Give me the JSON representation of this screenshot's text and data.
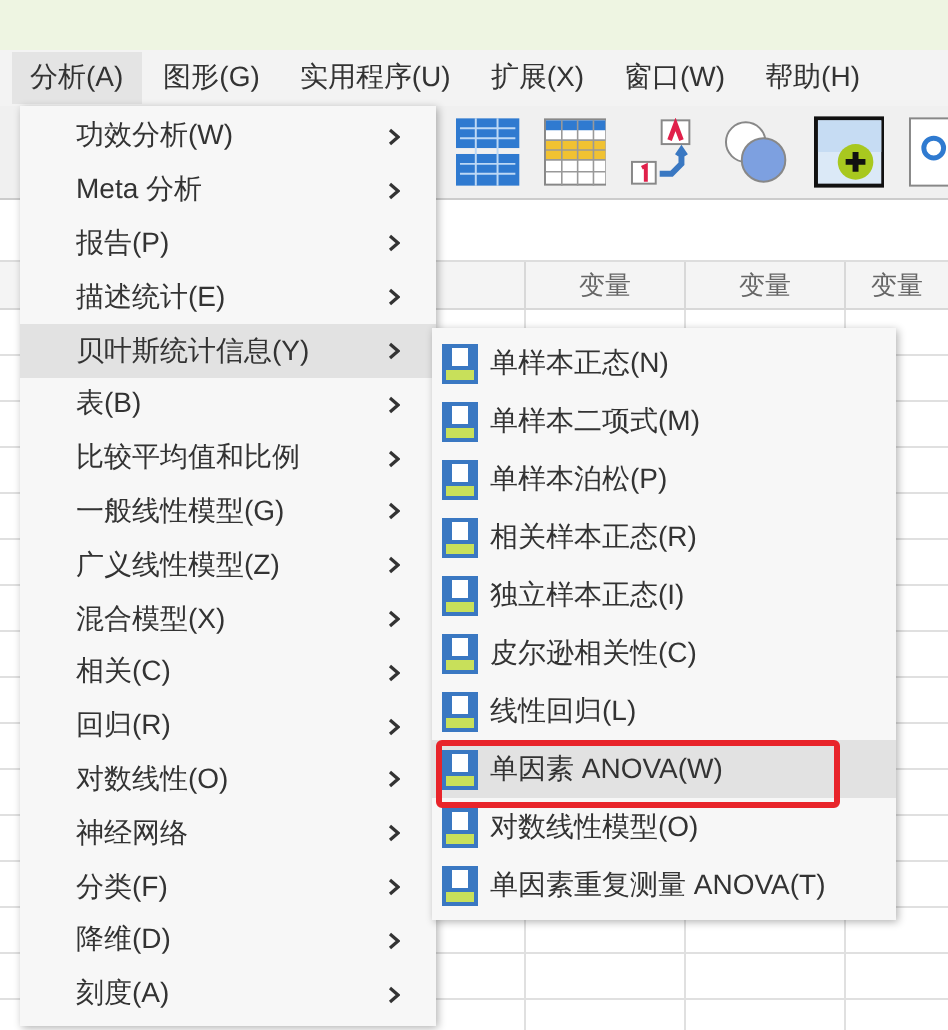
{
  "menubar": [
    {
      "label": "分析(A)",
      "selected": true
    },
    {
      "label": "图形(G)",
      "selected": false
    },
    {
      "label": "实用程序(U)",
      "selected": false
    },
    {
      "label": "扩展(X)",
      "selected": false
    },
    {
      "label": "窗口(W)",
      "selected": false
    },
    {
      "label": "帮助(H)",
      "selected": false
    }
  ],
  "toolbar": [
    {
      "kind": "grid"
    },
    {
      "kind": "table"
    },
    {
      "kind": "label"
    },
    {
      "kind": "circles"
    },
    {
      "kind": "add"
    },
    {
      "kind": "search"
    }
  ],
  "grid": {
    "columns": [
      "变量",
      "变量",
      "变量"
    ]
  },
  "menu": [
    {
      "label": "功效分析(W)",
      "selected": false
    },
    {
      "label": "Meta 分析",
      "selected": false
    },
    {
      "label": "报告(P)",
      "selected": false
    },
    {
      "label": "描述统计(E)",
      "selected": false
    },
    {
      "label": "贝叶斯统计信息(Y)",
      "selected": true
    },
    {
      "label": "表(B)",
      "selected": false
    },
    {
      "label": "比较平均值和比例",
      "selected": false
    },
    {
      "label": "一般线性模型(G)",
      "selected": false
    },
    {
      "label": "广义线性模型(Z)",
      "selected": false
    },
    {
      "label": "混合模型(X)",
      "selected": false
    },
    {
      "label": "相关(C)",
      "selected": false
    },
    {
      "label": "回归(R)",
      "selected": false
    },
    {
      "label": "对数线性(O)",
      "selected": false
    },
    {
      "label": "神经网络",
      "selected": false
    },
    {
      "label": "分类(F)",
      "selected": false
    },
    {
      "label": "降维(D)",
      "selected": false
    },
    {
      "label": "刻度(A)",
      "selected": false
    }
  ],
  "submenu": [
    {
      "label": "单样本正态(N)",
      "selected": false,
      "annotated": false
    },
    {
      "label": "单样本二项式(M)",
      "selected": false,
      "annotated": false
    },
    {
      "label": "单样本泊松(P)",
      "selected": false,
      "annotated": false
    },
    {
      "label": "相关样本正态(R)",
      "selected": false,
      "annotated": false
    },
    {
      "label": "独立样本正态(I)",
      "selected": false,
      "annotated": false
    },
    {
      "label": "皮尔逊相关性(C)",
      "selected": false,
      "annotated": false
    },
    {
      "label": "线性回归(L)",
      "selected": false,
      "annotated": false
    },
    {
      "label": "单因素 ANOVA(W)",
      "selected": true,
      "annotated": true
    },
    {
      "label": "对数线性模型(O)",
      "selected": false,
      "annotated": false
    },
    {
      "label": "单因素重复测量 ANOVA(T)",
      "selected": false,
      "annotated": false
    }
  ]
}
